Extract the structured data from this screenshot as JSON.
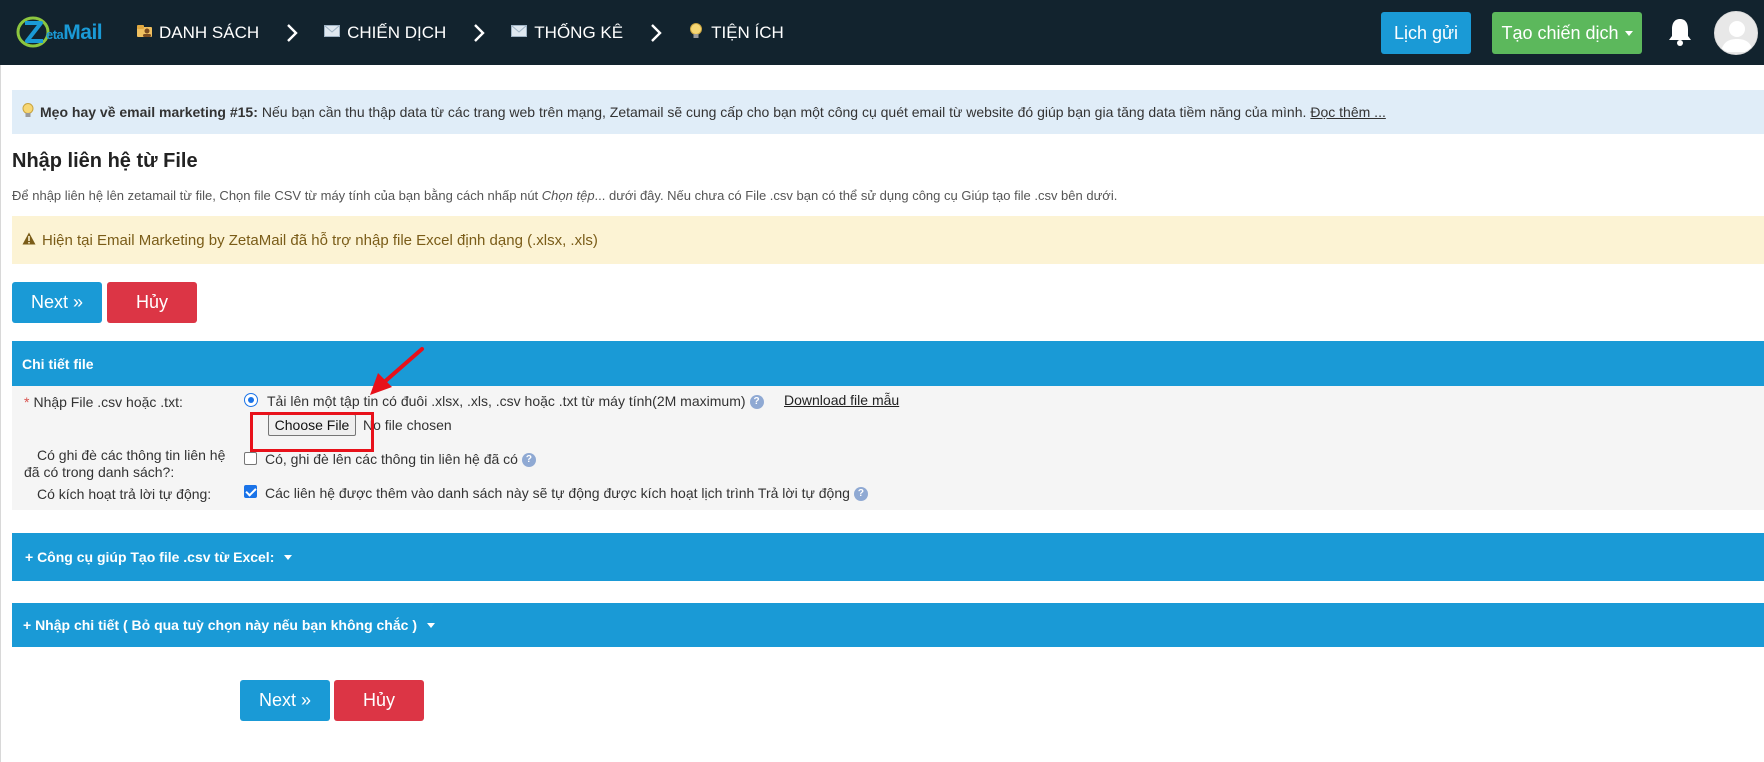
{
  "nav": {
    "logo_letter": "Z",
    "logo_rest": "eta",
    "logo_brand": "Mail",
    "items": [
      {
        "label": "DANH SÁCH",
        "icon": "folder-user-icon"
      },
      {
        "label": "CHIẾN DỊCH",
        "icon": "envelope-icon"
      },
      {
        "label": "THỐNG KÊ",
        "icon": "envelope-icon"
      },
      {
        "label": "TIỆN ÍCH",
        "icon": "lightbulb-icon"
      }
    ],
    "lich_gui": "Lịch gửi",
    "tao_chien_dich": "Tạo chiến dịch"
  },
  "tip": {
    "title": "Mẹo hay về email marketing #15:",
    "text": "Nếu bạn cần thu thập data từ các trang web trên mạng, Zetamail sẽ cung cấp cho bạn một công cụ quét email từ website đó giúp bạn gia tăng data tiềm năng của mình.",
    "link": "Đọc thêm ..."
  },
  "page": {
    "title": "Nhập liên hệ từ File",
    "desc_before": "Để nhập liên hệ lên zetamail từ file, Chọn file CSV từ máy tính của bạn bằng cách nhấp nút ",
    "desc_italic": "Chọn tệp",
    "desc_after": "... dưới đây. Nếu chưa có File .csv bạn có thể sử dụng công cụ Giúp tạo file .csv bên dưới."
  },
  "warning": "Hiện tại Email Marketing by ZetaMail đã hỗ trợ nhập file Excel định dạng (.xlsx, .xls)",
  "buttons": {
    "next": "Next »",
    "cancel": "Hủy"
  },
  "details": {
    "header": "Chi tiết file",
    "import_label": "Nhập File .csv hoặc .txt:",
    "import_required": "*",
    "upload_option": "Tải lên một tập tin có đuôi .xlsx, .xls, .csv hoặc .txt từ máy tính(2M maximum)",
    "download_sample": "Download file mẫu",
    "choose_file": "Choose File",
    "no_file": "No file chosen",
    "overwrite_label_1": "Có ghi đè các thông tin liên hệ",
    "overwrite_label_2": "đã có trong danh sách?:",
    "overwrite_option": "Có, ghi đè lên các thông tin liên hệ đã có",
    "overwrite_checked": false,
    "autoresponder_label": "Có kích hoạt trả lời tự động:",
    "autoresponder_option": "Các liên hệ được thêm vào danh sách này sẽ tự động được kích hoạt lịch trình Trả lời tự động",
    "autoresponder_checked": true
  },
  "tools_header": "+ Công cụ giúp Tạo file .csv từ Excel:",
  "advanced_header": "+  Nhập chi tiết ( Bỏ qua tuỳ chọn này nếu bạn không chắc )",
  "colors": {
    "topbar": "#12232e",
    "primary": "#1a9ad6",
    "success": "#5cb85c",
    "danger": "#dc3545",
    "highlight": "#e8111a"
  }
}
